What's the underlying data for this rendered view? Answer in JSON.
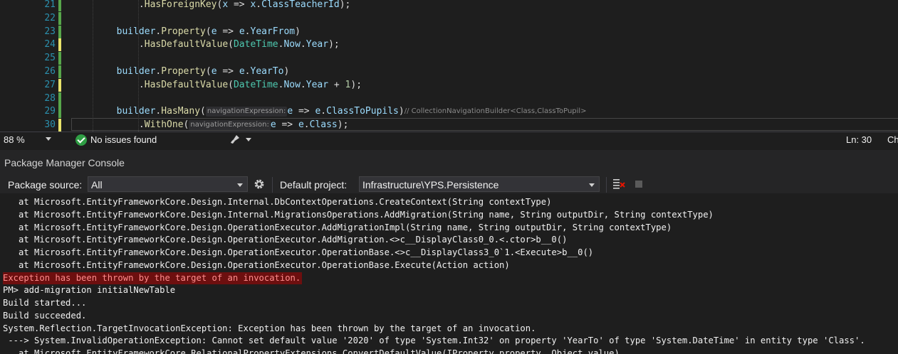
{
  "editor": {
    "lines": [
      {
        "num": "21",
        "mod": "g",
        "segments": [
          {
            "c": "w",
            "t": "            ."
          },
          {
            "c": "m",
            "t": "HasForeignKey"
          },
          {
            "c": "w",
            "t": "("
          },
          {
            "c": "p",
            "t": "x"
          },
          {
            "c": "w",
            "t": " => "
          },
          {
            "c": "p",
            "t": "x"
          },
          {
            "c": "w",
            "t": "."
          },
          {
            "c": "p",
            "t": "ClassTeacherId"
          },
          {
            "c": "w",
            "t": ");"
          }
        ]
      },
      {
        "num": "22",
        "mod": "g",
        "segments": []
      },
      {
        "num": "23",
        "mod": "g",
        "segments": [
          {
            "c": "w",
            "t": "        "
          },
          {
            "c": "p",
            "t": "builder"
          },
          {
            "c": "w",
            "t": "."
          },
          {
            "c": "m",
            "t": "Property"
          },
          {
            "c": "w",
            "t": "("
          },
          {
            "c": "p",
            "t": "e"
          },
          {
            "c": "w",
            "t": " => "
          },
          {
            "c": "p",
            "t": "e"
          },
          {
            "c": "w",
            "t": "."
          },
          {
            "c": "p",
            "t": "YearFrom"
          },
          {
            "c": "w",
            "t": ")"
          }
        ]
      },
      {
        "num": "24",
        "mod": "y",
        "segments": [
          {
            "c": "w",
            "t": "            ."
          },
          {
            "c": "m",
            "t": "HasDefaultValue"
          },
          {
            "c": "w",
            "t": "("
          },
          {
            "c": "t",
            "t": "DateTime"
          },
          {
            "c": "w",
            "t": "."
          },
          {
            "c": "p",
            "t": "Now"
          },
          {
            "c": "w",
            "t": "."
          },
          {
            "c": "p",
            "t": "Year"
          },
          {
            "c": "w",
            "t": ");"
          }
        ]
      },
      {
        "num": "25",
        "mod": "g",
        "segments": []
      },
      {
        "num": "26",
        "mod": "g",
        "segments": [
          {
            "c": "w",
            "t": "        "
          },
          {
            "c": "p",
            "t": "builder"
          },
          {
            "c": "w",
            "t": "."
          },
          {
            "c": "m",
            "t": "Property"
          },
          {
            "c": "w",
            "t": "("
          },
          {
            "c": "p",
            "t": "e"
          },
          {
            "c": "w",
            "t": " => "
          },
          {
            "c": "p",
            "t": "e"
          },
          {
            "c": "w",
            "t": "."
          },
          {
            "c": "p",
            "t": "YearTo"
          },
          {
            "c": "w",
            "t": ")"
          }
        ]
      },
      {
        "num": "27",
        "mod": "y",
        "segments": [
          {
            "c": "w",
            "t": "            ."
          },
          {
            "c": "m",
            "t": "HasDefaultValue"
          },
          {
            "c": "w",
            "t": "("
          },
          {
            "c": "t",
            "t": "DateTime"
          },
          {
            "c": "w",
            "t": "."
          },
          {
            "c": "p",
            "t": "Now"
          },
          {
            "c": "w",
            "t": "."
          },
          {
            "c": "p",
            "t": "Year"
          },
          {
            "c": "w",
            "t": " + "
          },
          {
            "c": "n",
            "t": "1"
          },
          {
            "c": "w",
            "t": ");"
          }
        ]
      },
      {
        "num": "28",
        "mod": "g",
        "segments": []
      },
      {
        "num": "29",
        "mod": "g",
        "segments": [
          {
            "c": "w",
            "t": "        "
          },
          {
            "c": "p",
            "t": "builder"
          },
          {
            "c": "w",
            "t": "."
          },
          {
            "c": "m",
            "t": "HasMany"
          },
          {
            "c": "w",
            "t": "("
          },
          {
            "c": "hint",
            "t": "navigationExpression:"
          },
          {
            "c": "p",
            "t": "e"
          },
          {
            "c": "w",
            "t": " => "
          },
          {
            "c": "p",
            "t": "e"
          },
          {
            "c": "w",
            "t": "."
          },
          {
            "c": "p",
            "t": "ClassToPupils"
          },
          {
            "c": "w",
            "t": ")"
          },
          {
            "c": "ghost",
            "t": "// CollectionNavigationBuilder<Class,ClassToPupil>"
          }
        ]
      },
      {
        "num": "30",
        "mod": "y",
        "segments": [
          {
            "c": "w",
            "t": "            ."
          },
          {
            "c": "m",
            "t": "WithOne"
          },
          {
            "c": "w",
            "t": "("
          },
          {
            "c": "hint",
            "t": "navigationExpression:"
          },
          {
            "c": "p",
            "t": "e"
          },
          {
            "c": "w",
            "t": " => "
          },
          {
            "c": "p",
            "t": "e"
          },
          {
            "c": "w",
            "t": "."
          },
          {
            "c": "p",
            "t": "Class"
          },
          {
            "c": "w",
            "t": ");"
          }
        ]
      }
    ]
  },
  "status": {
    "zoom": "88 %",
    "issues": "No issues found",
    "line": "Ln: 30",
    "col": "Ch"
  },
  "pmc": {
    "title": "Package Manager Console",
    "source_label": "Package source:",
    "source_value": "All",
    "project_label": "Default project:",
    "project_value": "Infrastructure\\YPS.Persistence",
    "lines": [
      {
        "t": "   at Microsoft.EntityFrameworkCore.Design.Internal.DbContextOperations.CreateContext(String contextType)",
        "err": false
      },
      {
        "t": "   at Microsoft.EntityFrameworkCore.Design.Internal.MigrationsOperations.AddMigration(String name, String outputDir, String contextType)",
        "err": false
      },
      {
        "t": "   at Microsoft.EntityFrameworkCore.Design.OperationExecutor.AddMigrationImpl(String name, String outputDir, String contextType)",
        "err": false
      },
      {
        "t": "   at Microsoft.EntityFrameworkCore.Design.OperationExecutor.AddMigration.<>c__DisplayClass0_0.<.ctor>b__0()",
        "err": false
      },
      {
        "t": "   at Microsoft.EntityFrameworkCore.Design.OperationExecutor.OperationBase.<>c__DisplayClass3_0`1.<Execute>b__0()",
        "err": false
      },
      {
        "t": "   at Microsoft.EntityFrameworkCore.Design.OperationExecutor.OperationBase.Execute(Action action)",
        "err": false
      },
      {
        "t": "Exception has been thrown by the target of an invocation.",
        "err": true
      },
      {
        "t": "PM> add-migration initialNewTable",
        "err": false
      },
      {
        "t": "Build started...",
        "err": false
      },
      {
        "t": "Build succeeded.",
        "err": false
      },
      {
        "t": "System.Reflection.TargetInvocationException: Exception has been thrown by the target of an invocation.",
        "err": false
      },
      {
        "t": " ---> System.InvalidOperationException: Cannot set default value '2020' of type 'System.Int32' on property 'YearTo' of type 'System.DateTime' in entity type 'Class'.",
        "err": false
      },
      {
        "t": "   at Microsoft.EntityFrameworkCore.RelationalPropertyExtensions.ConvertDefaultValue(IProperty property, Object value)",
        "err": false
      }
    ]
  },
  "icons": {
    "ok": "check-circle-icon",
    "brush": "code-cleanup-brush-icon",
    "gear": "gear-icon",
    "clear": "clear-console-icon",
    "stop": "stop-icon"
  }
}
